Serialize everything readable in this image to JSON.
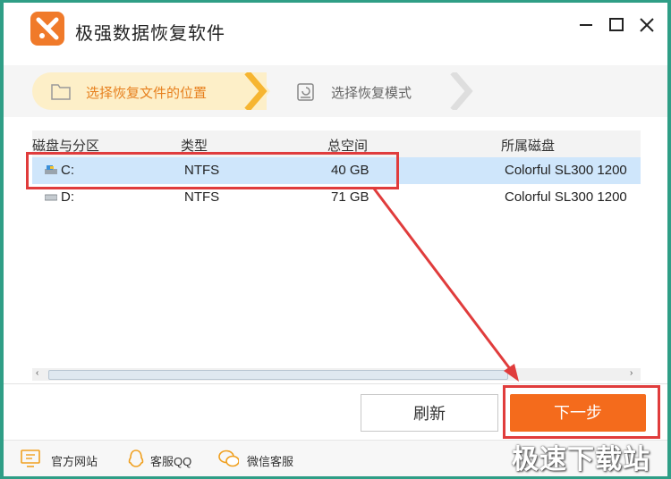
{
  "app": {
    "title": "极强数据恢复软件"
  },
  "steps": [
    {
      "label": "选择恢复文件的位置",
      "active": true
    },
    {
      "label": "选择恢复模式",
      "active": false
    }
  ],
  "table": {
    "columns": [
      "磁盘与分区",
      "类型",
      "总空间",
      "所属磁盘"
    ],
    "rows": [
      {
        "partition": "C:",
        "type": "NTFS",
        "size": "40 GB",
        "disk": "Colorful SL300 1200",
        "selected": true
      },
      {
        "partition": "D:",
        "type": "NTFS",
        "size": "71 GB",
        "disk": "Colorful SL300 1200",
        "selected": false
      }
    ]
  },
  "buttons": {
    "refresh": "刷新",
    "next": "下一步"
  },
  "footer": {
    "website": "官方网站",
    "qq": "客服QQ",
    "wechat": "微信客服"
  },
  "watermark": "极速下载站",
  "colors": {
    "accent": "#f46b1c",
    "selection": "#cfe6fb",
    "annotation": "#e03c3c"
  }
}
